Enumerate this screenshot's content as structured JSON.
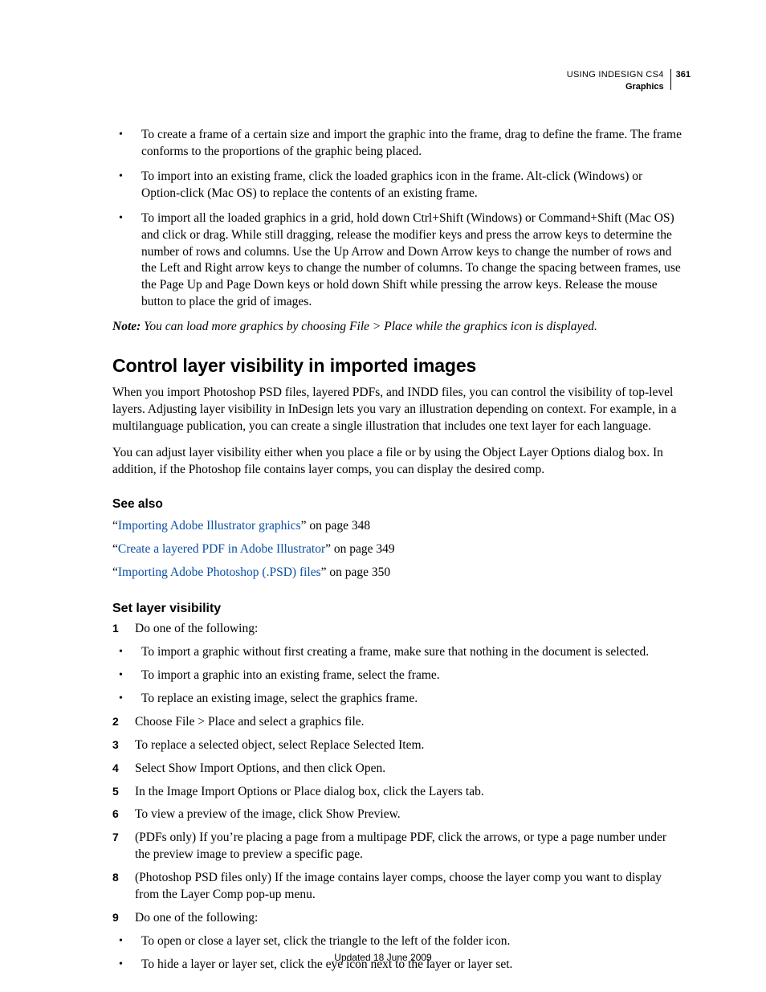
{
  "header": {
    "line1": "USING INDESIGN CS4",
    "line2": "Graphics",
    "page": "361"
  },
  "top_bullets": [
    "To create a frame of a certain size and import the graphic into the frame, drag to define the frame. The frame conforms to the proportions of the graphic being placed.",
    "To import into an existing frame, click the loaded graphics icon in the frame. Alt-click (Windows) or Option-click (Mac OS) to replace the contents of an existing frame.",
    "To import all the loaded graphics in a grid, hold down Ctrl+Shift (Windows) or Command+Shift (Mac OS) and click or drag. While still dragging, release the modifier keys and press the arrow keys to determine the number of rows and columns. Use the Up Arrow and Down Arrow keys to change the number of rows and the Left and Right arrow keys to change the number of columns. To change the spacing between frames, use the Page Up and Page Down keys or hold down Shift while pressing the arrow keys. Release the mouse button to place the grid of images."
  ],
  "note": {
    "label": "Note:",
    "body": " You can load more graphics by choosing File > Place while the graphics icon is displayed."
  },
  "h2": "Control layer visibility in imported images",
  "intro1": "When you import Photoshop PSD files, layered PDFs, and INDD files, you can control the visibility of top-level layers. Adjusting layer visibility in InDesign lets you vary an illustration depending on context. For example, in a multilanguage publication, you can create a single illustration that includes one text layer for each language.",
  "intro2": "You can adjust layer visibility either when you place a file or by using the Object Layer Options dialog box. In addition, if the Photoshop file contains layer comps, you can display the desired comp.",
  "seealso": {
    "heading": "See also",
    "items": [
      {
        "q1": "“",
        "link": "Importing Adobe Illustrator graphics",
        "q2": "” on page 348"
      },
      {
        "q1": "“",
        "link": "Create a layered PDF in Adobe Illustrator",
        "q2": "” on page 349"
      },
      {
        "q1": "“",
        "link": "Importing Adobe Photoshop (.PSD) files",
        "q2": "” on page 350"
      }
    ]
  },
  "h4": "Set layer visibility",
  "steps": [
    {
      "m": "1",
      "t": "Do one of the following:"
    },
    {
      "m": "•",
      "t": "To import a graphic without first creating a frame, make sure that nothing in the document is selected."
    },
    {
      "m": "•",
      "t": "To import a graphic into an existing frame, select the frame."
    },
    {
      "m": "•",
      "t": "To replace an existing image, select the graphics frame."
    },
    {
      "m": "2",
      "t": "Choose File > Place and select a graphics file."
    },
    {
      "m": "3",
      "t": "To replace a selected object, select Replace Selected Item."
    },
    {
      "m": "4",
      "t": "Select Show Import Options, and then click Open."
    },
    {
      "m": "5",
      "t": "In the Image Import Options or Place dialog box, click the Layers tab."
    },
    {
      "m": "6",
      "t": "To view a preview of the image, click Show Preview."
    },
    {
      "m": "7",
      "t": "(PDFs only) If you’re placing a page from a multipage PDF, click the arrows, or type a page number under the preview image to preview a specific page."
    },
    {
      "m": "8",
      "t": "(Photoshop PSD files only) If the image contains layer comps, choose the layer comp you want to display from the Layer Comp pop-up menu."
    },
    {
      "m": "9",
      "t": "Do one of the following:"
    },
    {
      "m": "•",
      "t": "To open or close a layer set, click the triangle to the left of the folder icon."
    },
    {
      "m": "•",
      "t": "To hide a layer or layer set, click the eye icon next to the layer or layer set."
    }
  ],
  "footer": "Updated 18 June 2009"
}
